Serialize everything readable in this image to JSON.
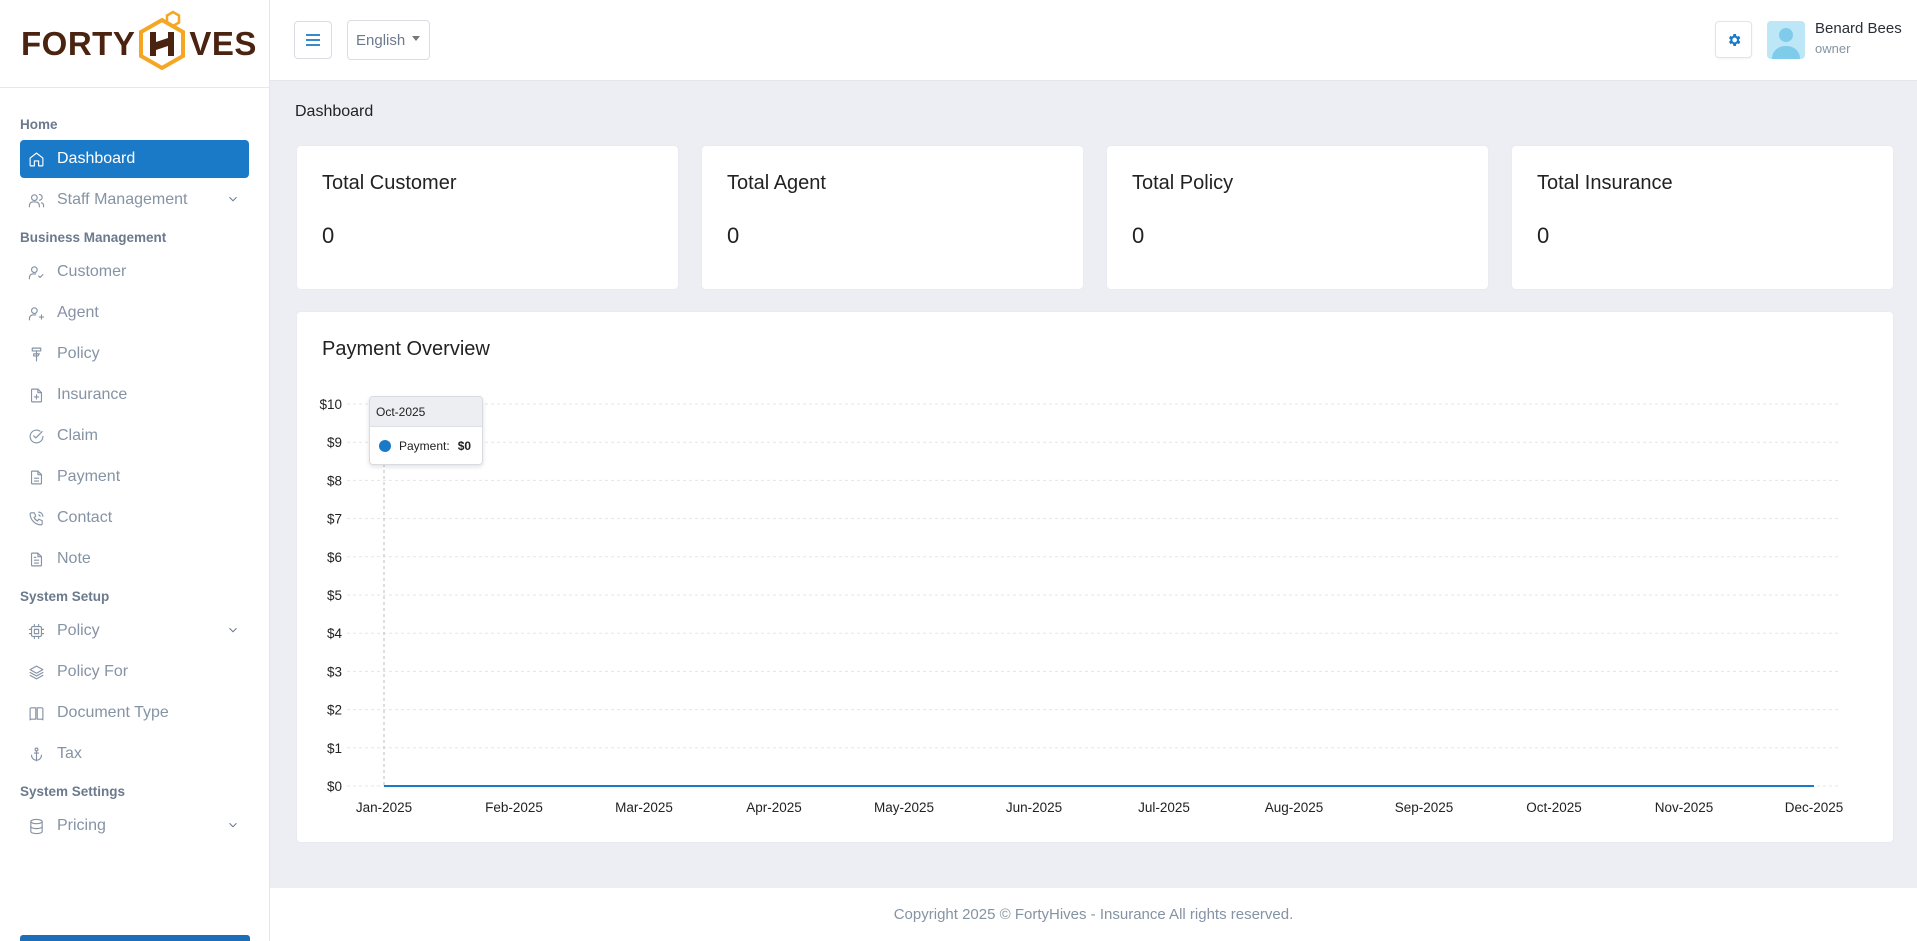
{
  "brand": {
    "left": "FORTY",
    "h": "H",
    "right": "VES",
    "colors": {
      "text": "#4a2410",
      "hex": "#f5a623"
    }
  },
  "sidebar": {
    "sections": [
      {
        "label": "Home",
        "items": [
          {
            "label": "Dashboard",
            "icon": "home-icon",
            "active": true
          },
          {
            "label": "Staff Management",
            "icon": "users-icon",
            "expandable": true
          }
        ]
      },
      {
        "label": "Business Management",
        "items": [
          {
            "label": "Customer",
            "icon": "user-check-icon"
          },
          {
            "label": "Agent",
            "icon": "user-plus-icon"
          },
          {
            "label": "Policy",
            "icon": "policy-icon"
          },
          {
            "label": "Insurance",
            "icon": "file-plus-icon"
          },
          {
            "label": "Claim",
            "icon": "circle-check-icon"
          },
          {
            "label": "Payment",
            "icon": "file-icon"
          },
          {
            "label": "Contact",
            "icon": "phone-icon"
          },
          {
            "label": "Note",
            "icon": "note-icon"
          }
        ]
      },
      {
        "label": "System Setup",
        "items": [
          {
            "label": "Policy",
            "icon": "cpu-icon",
            "expandable": true
          },
          {
            "label": "Policy For",
            "icon": "layers-icon"
          },
          {
            "label": "Document Type",
            "icon": "book-icon"
          },
          {
            "label": "Tax",
            "icon": "anchor-icon"
          }
        ]
      },
      {
        "label": "System Settings",
        "items": [
          {
            "label": "Pricing",
            "icon": "database-icon",
            "expandable": true
          }
        ]
      }
    ]
  },
  "header": {
    "language": "English",
    "user": {
      "name": "Benard Bees",
      "role": "owner"
    }
  },
  "breadcrumb": "Dashboard",
  "stats": [
    {
      "title": "Total Customer",
      "value": "0"
    },
    {
      "title": "Total Agent",
      "value": "0"
    },
    {
      "title": "Total Policy",
      "value": "0"
    },
    {
      "title": "Total Insurance",
      "value": "0"
    }
  ],
  "payment_overview": {
    "title": "Payment Overview",
    "tooltip": {
      "month": "Oct-2025",
      "series": "Payment:",
      "value": "$0"
    }
  },
  "chart_data": {
    "type": "line",
    "title": "Payment Overview",
    "categories": [
      "Jan-2025",
      "Feb-2025",
      "Mar-2025",
      "Apr-2025",
      "May-2025",
      "Jun-2025",
      "Jul-2025",
      "Aug-2025",
      "Sep-2025",
      "Oct-2025",
      "Nov-2025",
      "Dec-2025"
    ],
    "series": [
      {
        "name": "Payment",
        "values": [
          0,
          0,
          0,
          0,
          0,
          0,
          0,
          0,
          0,
          0,
          0,
          0
        ],
        "color": "#1b7ac8"
      }
    ],
    "y_ticks": [
      "$0",
      "$1",
      "$2",
      "$3",
      "$4",
      "$5",
      "$6",
      "$7",
      "$8",
      "$9",
      "$10"
    ],
    "ylim": [
      0,
      10
    ],
    "grid": true
  },
  "footer": "Copyright 2025 © FortyHives - Insurance All rights reserved.",
  "colors": {
    "primary": "#1b7ac8",
    "background": "#eceef3",
    "muted_text": "#8593a4"
  }
}
